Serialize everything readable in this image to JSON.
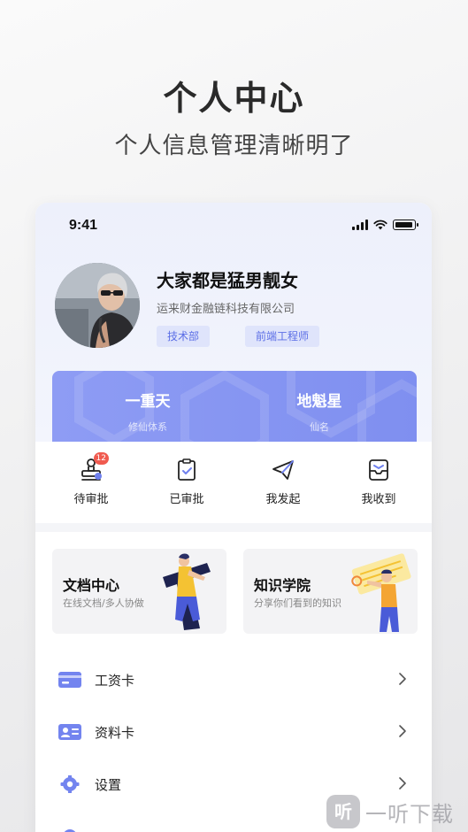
{
  "promo": {
    "title": "个人中心",
    "subtitle": "个人信息管理清晰明了"
  },
  "status_bar": {
    "time": "9:41"
  },
  "profile": {
    "name": "大家都是猛男靓女",
    "company": "运来财金融链科技有限公司",
    "tags": [
      "技术部",
      "前端工程师"
    ]
  },
  "stats": [
    {
      "value": "一重天",
      "label": "修仙体系"
    },
    {
      "value": "地魁星",
      "label": "仙名"
    }
  ],
  "quick_actions": [
    {
      "label": "待审批",
      "icon": "stamp-icon",
      "badge": "12"
    },
    {
      "label": "已审批",
      "icon": "clipboard-check-icon"
    },
    {
      "label": "我发起",
      "icon": "paper-plane-icon"
    },
    {
      "label": "我收到",
      "icon": "inbox-icon"
    }
  ],
  "cards": [
    {
      "title": "文档中心",
      "subtitle": "在线文档/多人协做"
    },
    {
      "title": "知识学院",
      "subtitle": "分享你们看到的知识"
    }
  ],
  "menu": [
    {
      "label": "工资卡",
      "icon": "bank-card-icon"
    },
    {
      "label": "资料卡",
      "icon": "id-card-icon"
    },
    {
      "label": "设置",
      "icon": "gear-icon"
    }
  ],
  "watermark": {
    "logo_text": "听",
    "text": "一听下载"
  },
  "colors": {
    "accent": "#6f80ee",
    "banner": "#8796f2",
    "tag_bg": "#dfe4fb",
    "badge": "#f05a4f"
  }
}
